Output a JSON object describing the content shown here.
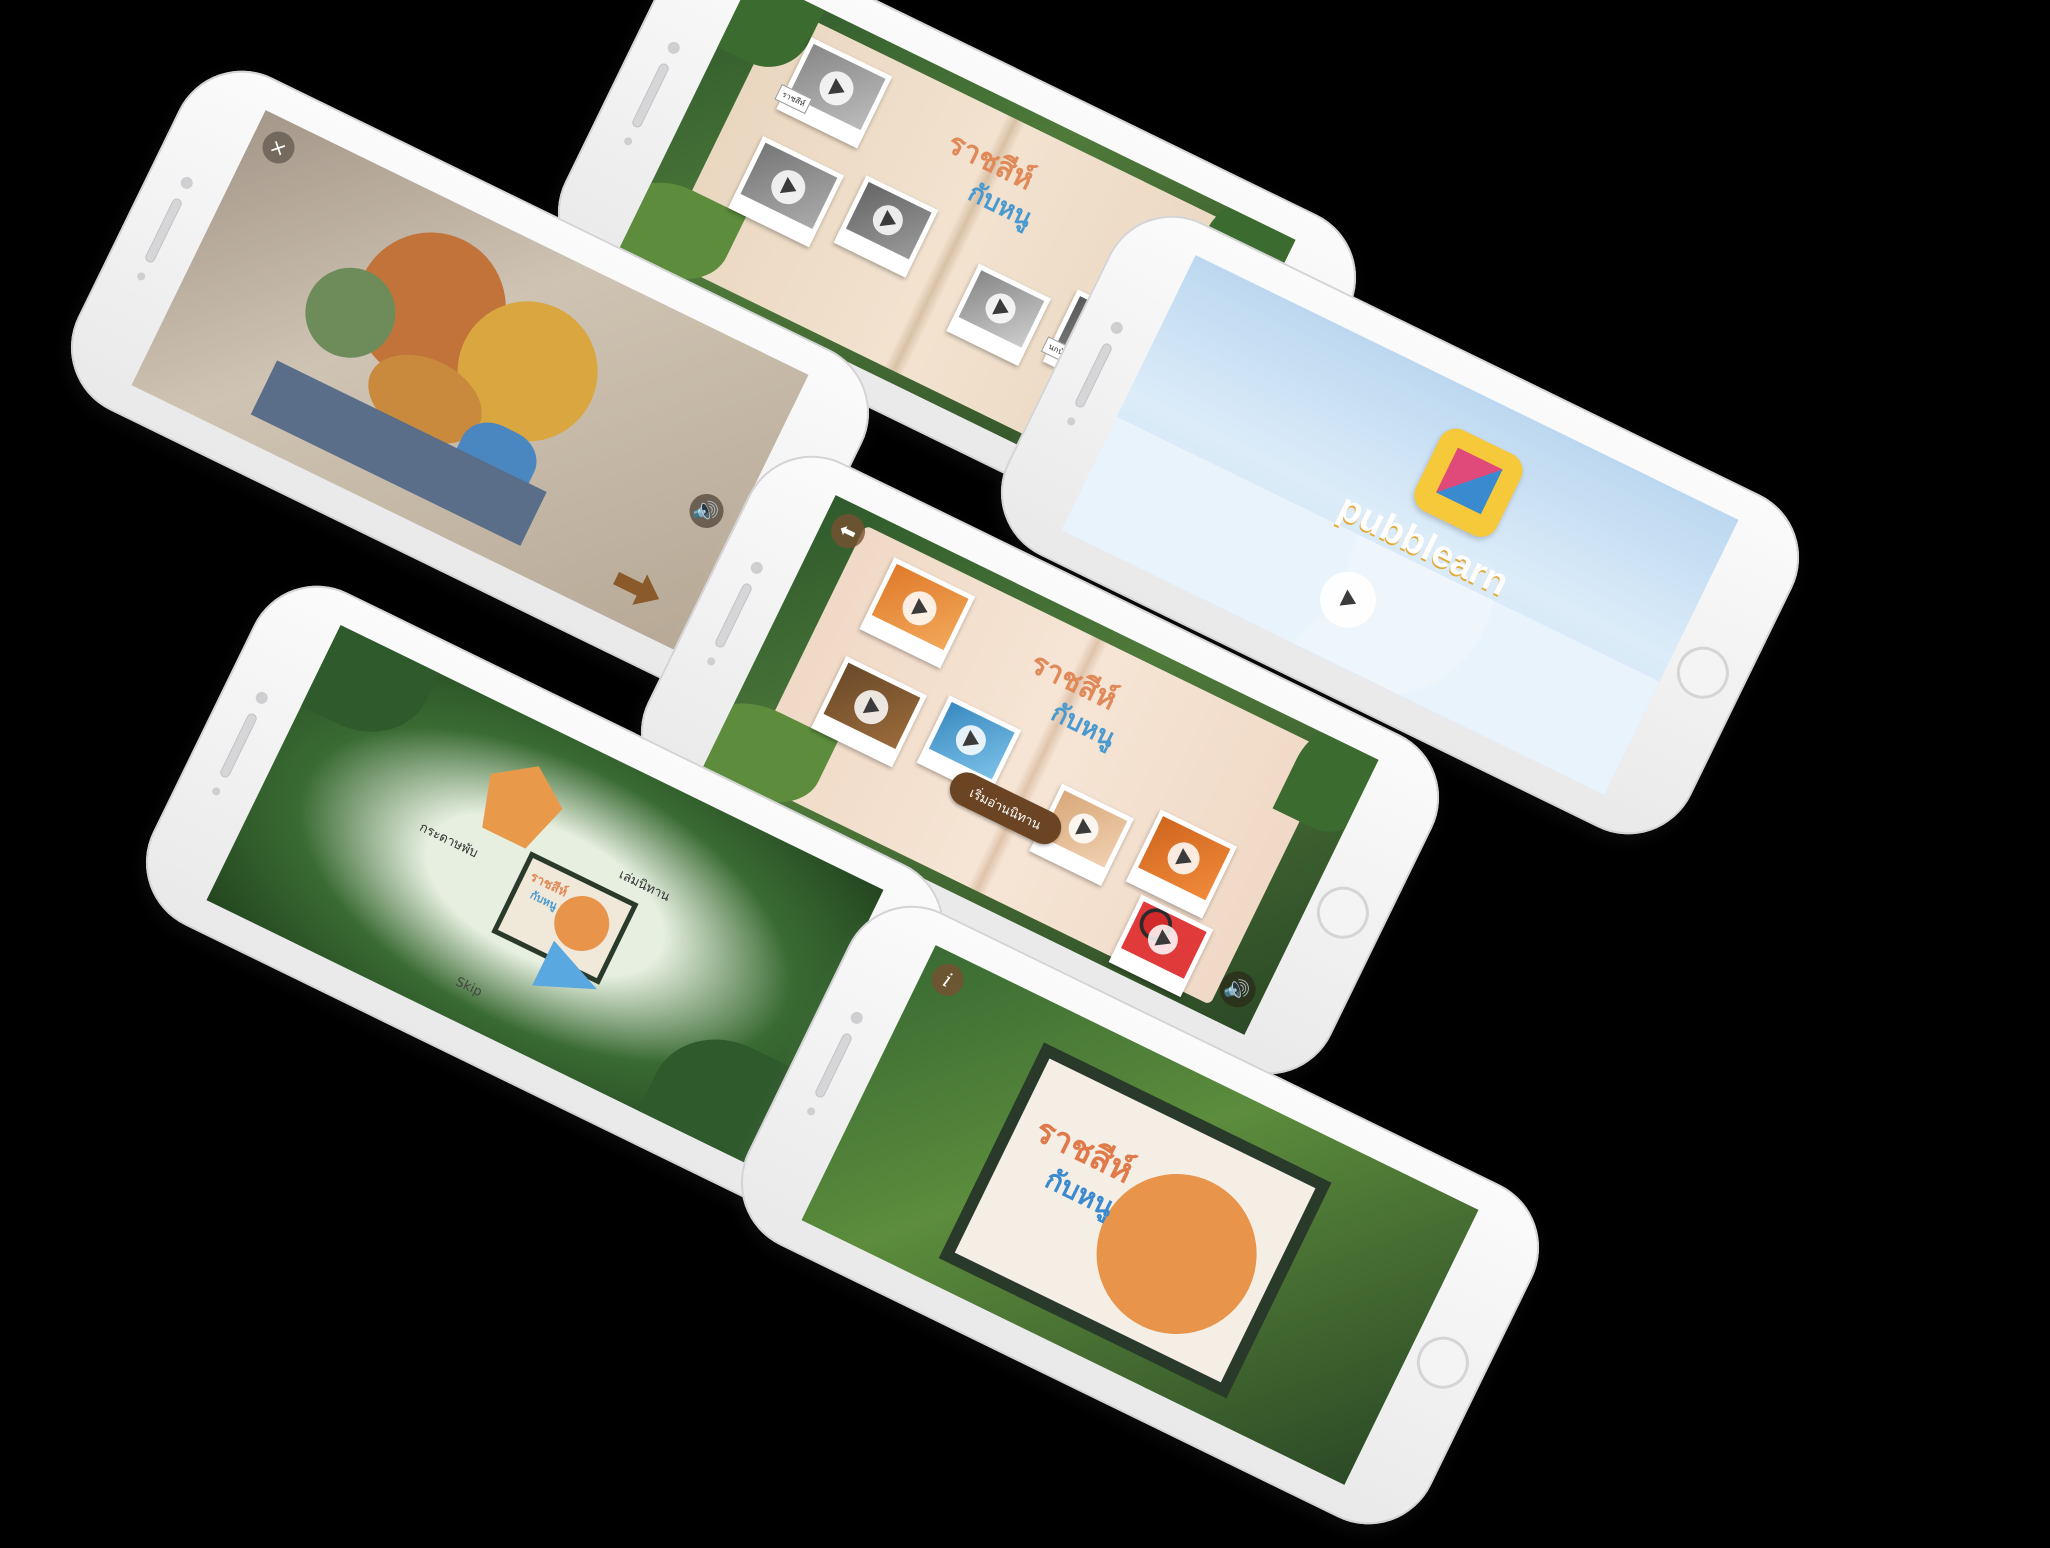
{
  "phones": [
    {
      "id": "top-book-grey",
      "title_line1": "ราชสีห์",
      "title_line2": "กับหนู",
      "card_tags": [
        "ราชสีห์",
        "",
        "",
        "",
        "นกน้อย",
        "ชื่อ"
      ]
    },
    {
      "id": "ar-camera",
      "close_label": "×"
    },
    {
      "id": "pubb-learn",
      "logo_text": "pubblearn"
    },
    {
      "id": "center-book-color",
      "title_line1": "ราชสีห์",
      "title_line2": "กับหนู",
      "start_button": "เริ่มอ่านนิทาน"
    },
    {
      "id": "intro-menu",
      "title_line1": "ราชสีห์",
      "title_line2": "กับหนู",
      "menu_origami": "กระดาษพับ",
      "menu_read": "เล่มนิทาน",
      "skip_label": "Skip"
    },
    {
      "id": "bottom-cover",
      "title_line1": "ราชสีห์",
      "title_line2": "กับหนู",
      "info_label": "i"
    }
  ],
  "icons": {
    "sound": "speaker-icon",
    "back": "back-arrow-icon",
    "close": "close-icon",
    "play": "play-icon",
    "next": "next-arrow-icon"
  }
}
